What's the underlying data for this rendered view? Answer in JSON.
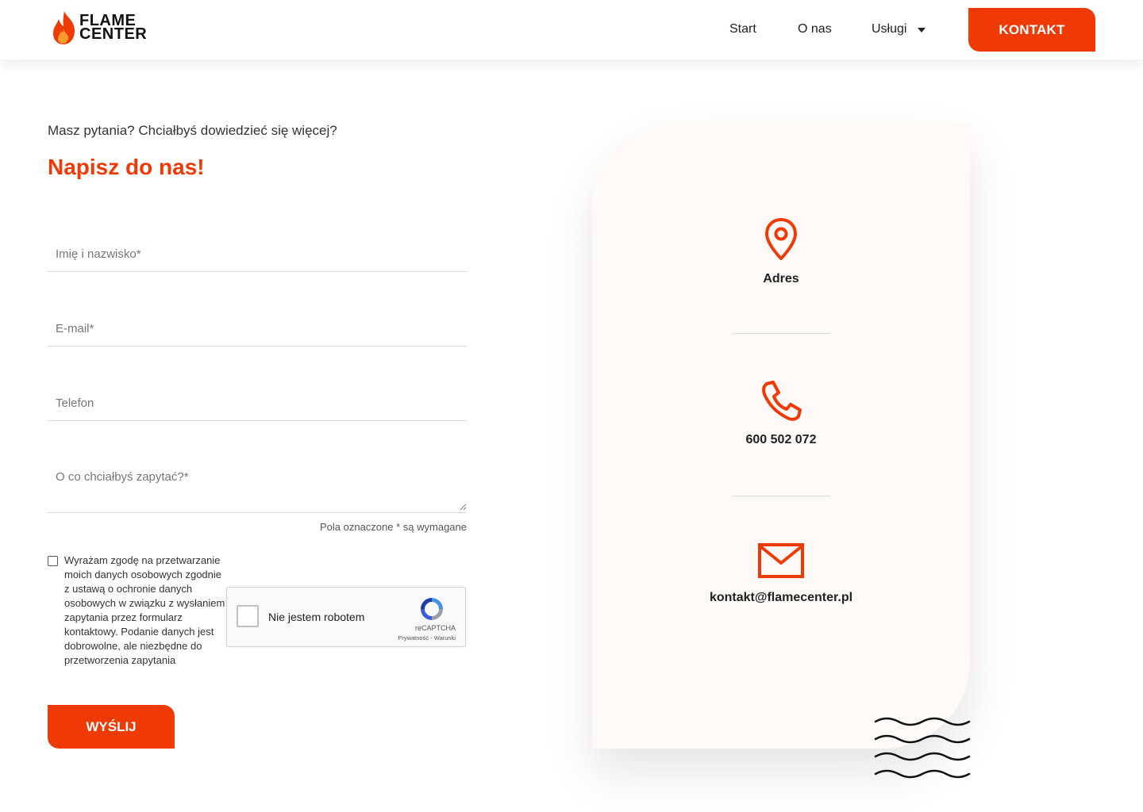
{
  "header": {
    "logo": {
      "line1": "FLAME",
      "line2": "CENTER",
      "icon": "flame-icon"
    },
    "nav": [
      {
        "label": "Start"
      },
      {
        "label": "O nas"
      },
      {
        "label": "Usługi",
        "icon": "caret-down-icon"
      }
    ],
    "cta_label": "KONTAKT"
  },
  "form": {
    "eyebrow": "Masz pytania? Chciałbyś dowiedzieć się więcej?",
    "title": "Napisz do nas!",
    "fields": {
      "name_placeholder": "Imię i nazwisko*",
      "email_placeholder": "E-mail*",
      "phone_placeholder": "Telefon",
      "message_placeholder": "O co chciałbyś zapytać?*"
    },
    "required_note": "Pola oznaczone * są wymagane",
    "consent_text": "Wyrażam zgodę na przetwarzanie moich danych osobowych zgodnie z ustawą o ochronie danych osobowych w związku z wysłaniem zapytania przez formularz kontaktowy. Podanie danych jest dobrowolne, ale niezbędne do przetworzenia zapytania",
    "recaptcha": {
      "label": "Nie jestem robotem",
      "brand": "reCAPTCHA",
      "links": "Prywatność - Warunki"
    },
    "submit_label": "WYŚLIJ"
  },
  "contact": {
    "address_label": "Adres",
    "phone": "600 502 072",
    "email": "kontakt@flamecenter.pl",
    "icons": [
      "location-pin-icon",
      "phone-icon",
      "envelope-icon"
    ]
  },
  "colors": {
    "accent": "#f03a05",
    "card_bg": "#fffaf7",
    "text": "#222222"
  }
}
